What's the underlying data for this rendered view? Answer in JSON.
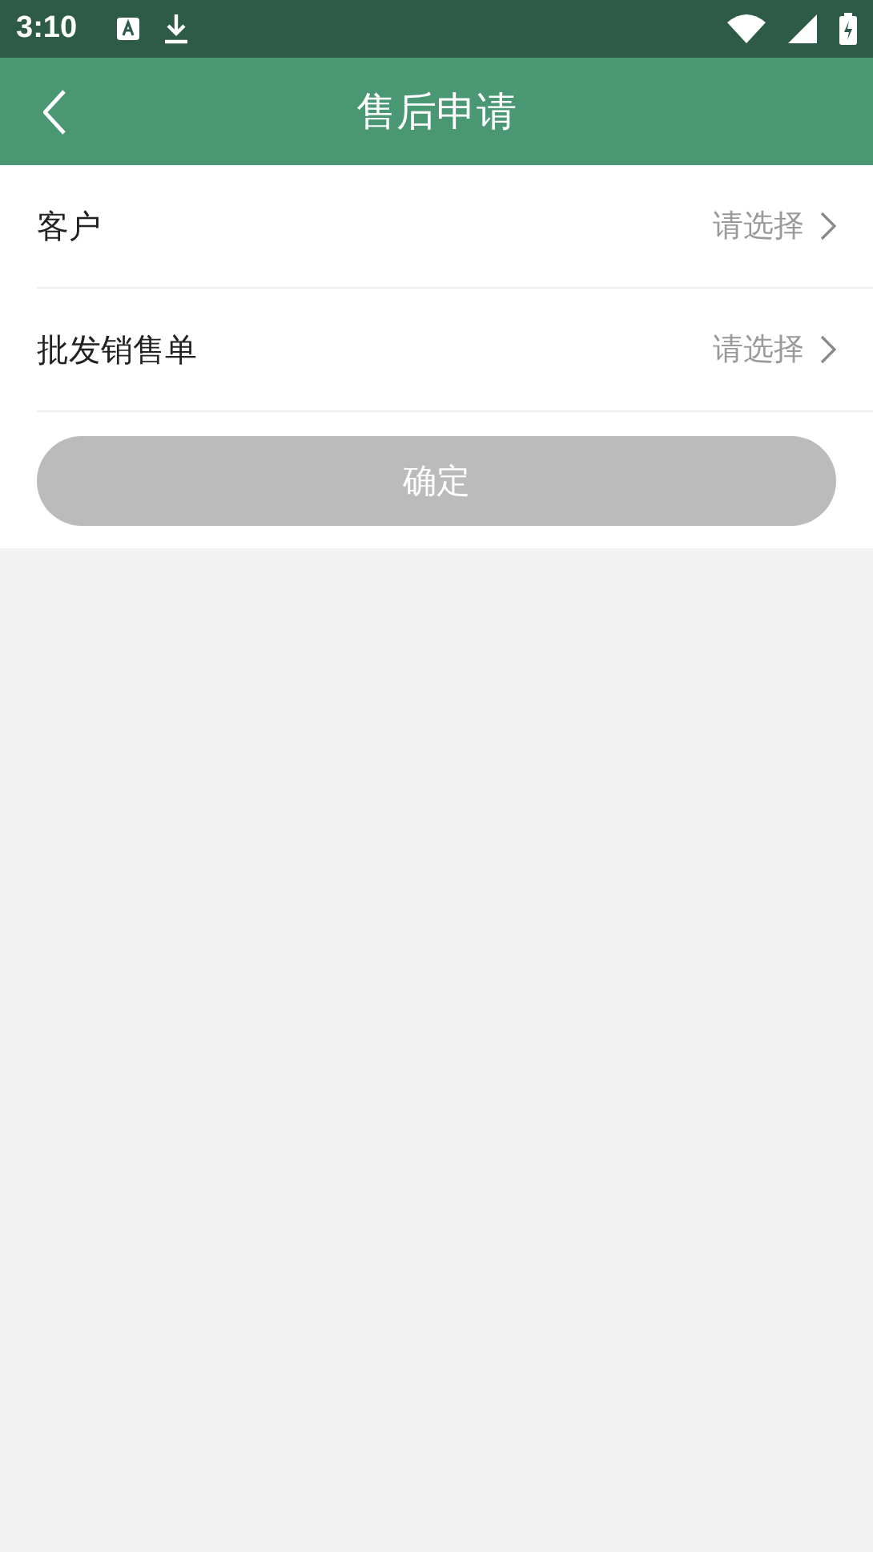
{
  "status_bar": {
    "time": "3:10"
  },
  "header": {
    "title": "售后申请"
  },
  "form_rows": [
    {
      "label": "客户",
      "placeholder": "请选择"
    },
    {
      "label": "批发销售单",
      "placeholder": "请选择"
    }
  ],
  "confirm_button": {
    "label": "确定",
    "disabled": true
  }
}
